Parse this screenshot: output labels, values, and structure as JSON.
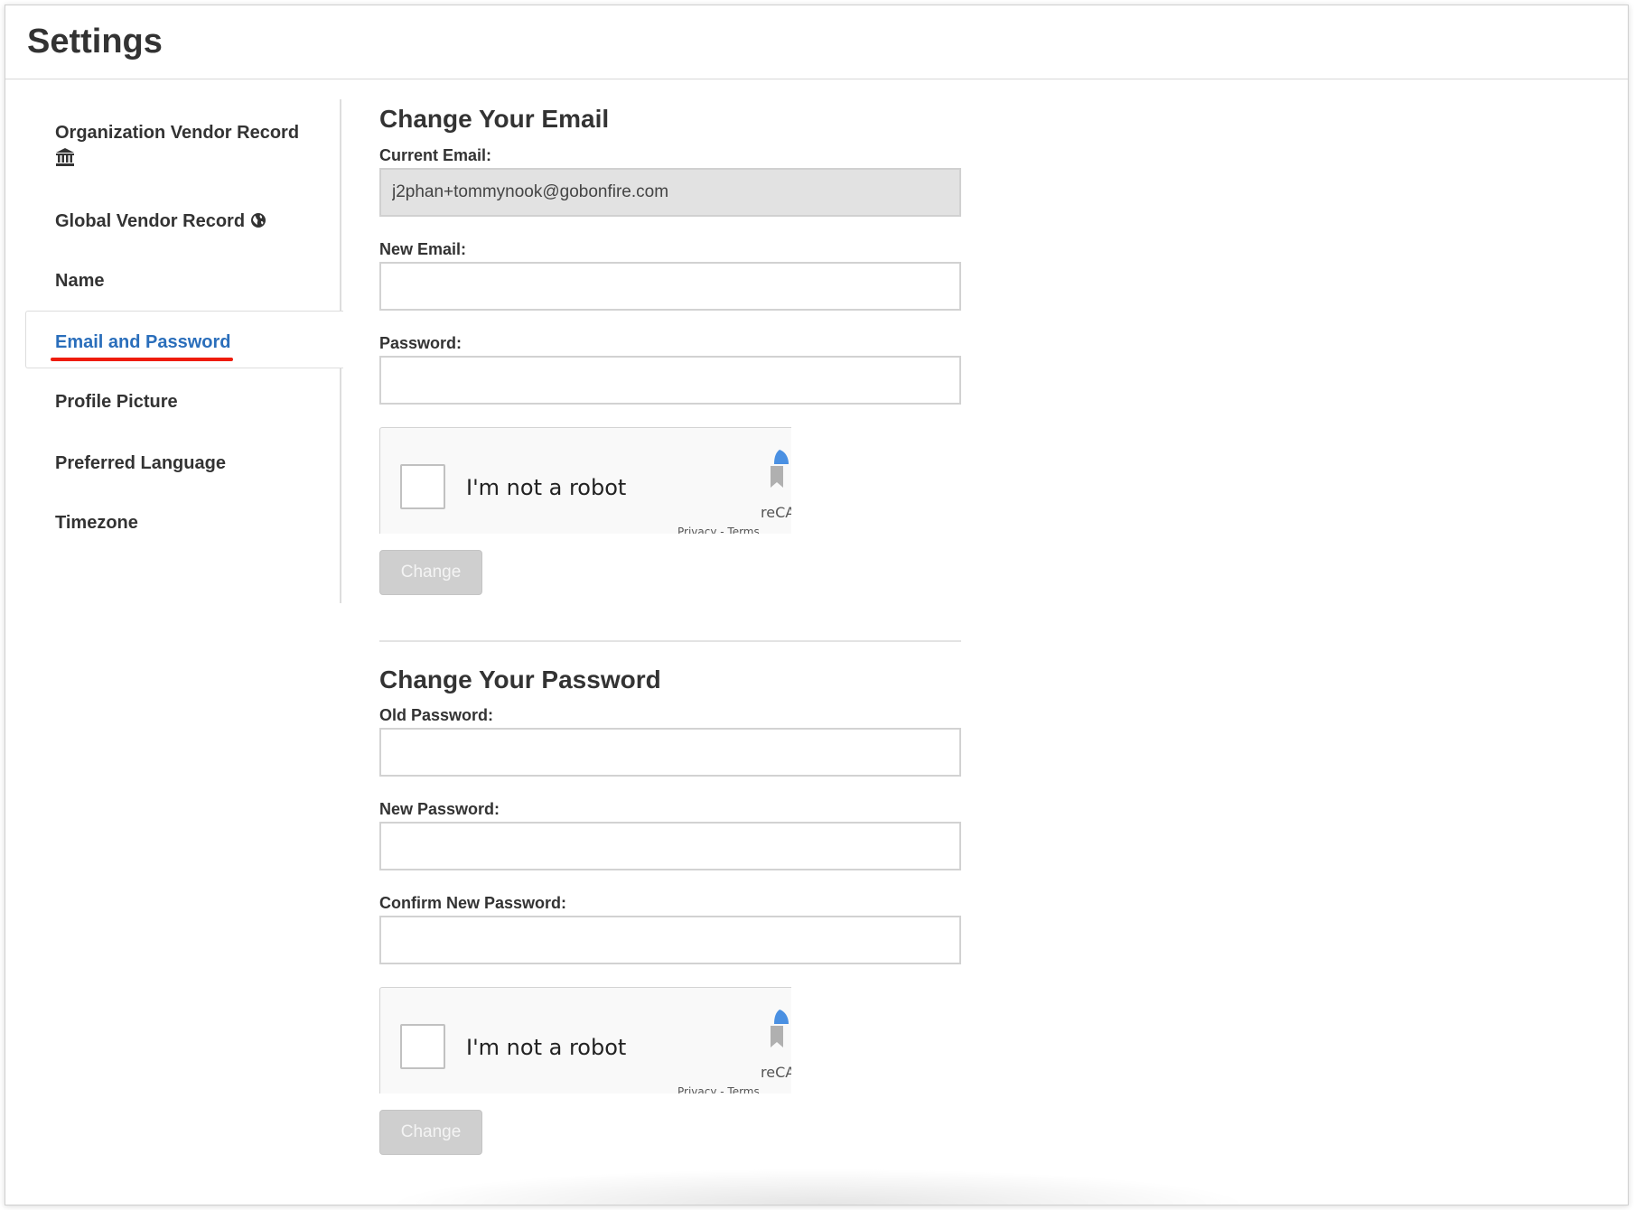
{
  "page": {
    "title": "Settings"
  },
  "sidebar": {
    "items": [
      {
        "label": "Organization Vendor Record",
        "icon": "bank-icon"
      },
      {
        "label": "Global Vendor Record",
        "icon": "globe-icon"
      },
      {
        "label": "Name"
      },
      {
        "label": "Email and Password",
        "active": true
      },
      {
        "label": "Profile Picture"
      },
      {
        "label": "Preferred Language"
      },
      {
        "label": "Timezone"
      }
    ],
    "active_color": "#2a6ebb",
    "underline_color": "#ee1c0c"
  },
  "change_email": {
    "title": "Change Your Email",
    "current_email_label": "Current Email:",
    "current_email_value": "j2phan+tommynook@gobonfire.com",
    "new_email_label": "New Email:",
    "new_email_value": "",
    "password_label": "Password:",
    "password_value": "",
    "captcha": {
      "label": "I'm not a robot",
      "brand": "reCAPTCHA",
      "links": "Privacy - Terms"
    },
    "button_label": "Change"
  },
  "change_password": {
    "title": "Change Your Password",
    "old_password_label": "Old Password:",
    "new_password_label": "New Password:",
    "confirm_password_label": "Confirm New Password:",
    "captcha": {
      "label": "I'm not a robot",
      "brand": "reCAPTCHA",
      "links": "Privacy - Terms"
    },
    "button_label": "Change"
  }
}
